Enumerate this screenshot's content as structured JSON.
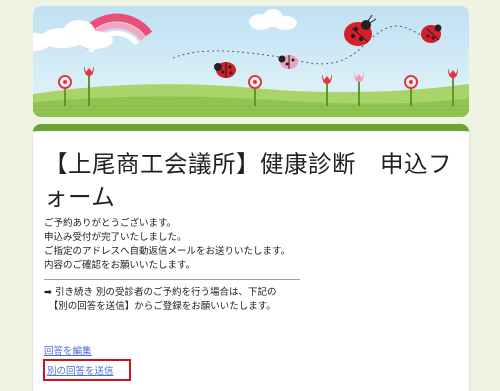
{
  "banner": {
    "description_icon": "ladybug-spring-banner"
  },
  "form": {
    "title": "【上尾商工会議所】健康診断　申込フォーム",
    "message_lines": [
      "ご予約ありがとうございます。",
      "申込み受付が完了いたしました。",
      "ご指定のアドレスへ自動返信メールをお送りいたします。",
      "内容のご確認をお願いいたします。"
    ],
    "note_lines": [
      "➡ 引き続き 別の受診者のご予約を行う場合は、下記の",
      "　【別の回答を送信】からご登録をお願いいたします。"
    ],
    "edit_link": "回答を編集",
    "send_another_link": "別の回答を送信"
  },
  "colors": {
    "accent": "#6aa531",
    "link": "#4a6fd6",
    "highlight": "#d0121b",
    "background": "#eef3e4"
  }
}
